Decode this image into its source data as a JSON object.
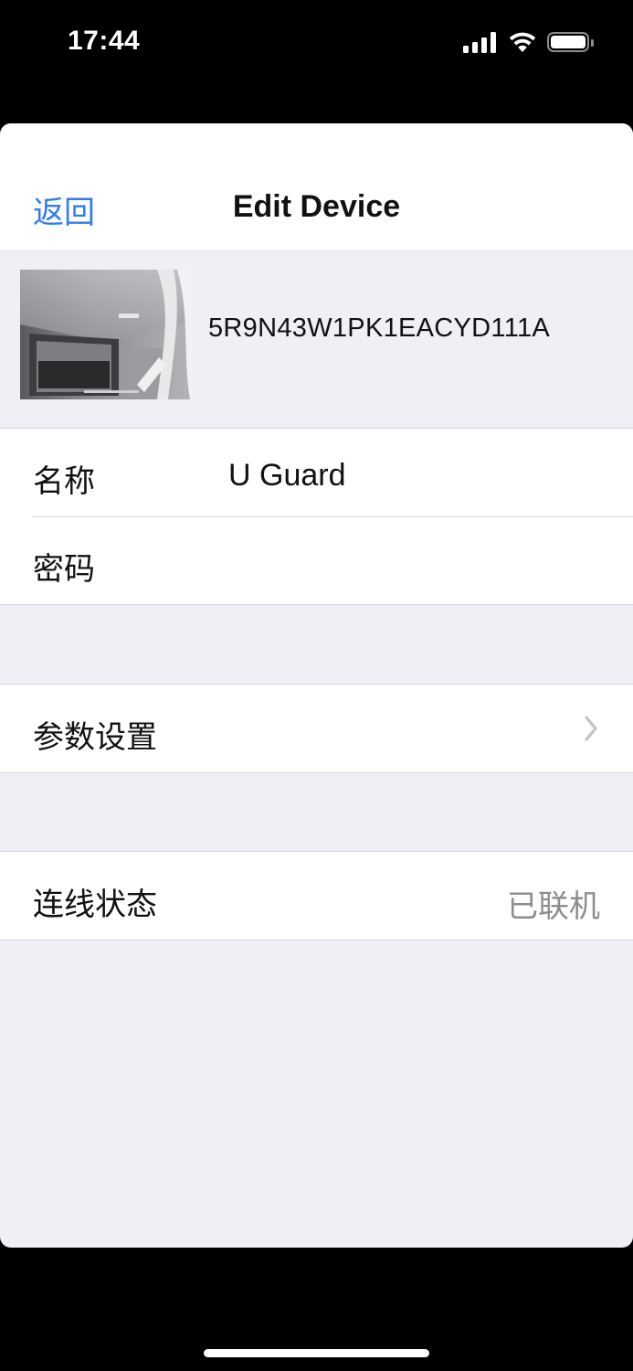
{
  "status_bar": {
    "time": "17:44",
    "icons": [
      "signal-icon",
      "wifi-icon",
      "battery-icon"
    ]
  },
  "nav": {
    "back_label": "返回",
    "title": "Edit Device"
  },
  "device": {
    "serial": "5R9N43W1PK1EACYD111A"
  },
  "info_group": {
    "name_label": "名称",
    "name_value": "U Guard",
    "password_label": "密码",
    "password_value": ""
  },
  "settings_group": {
    "params_label": "参数设置"
  },
  "status_group": {
    "connection_label": "连线状态",
    "connection_value": "已联机"
  },
  "colors": {
    "accent": "#2f7cf6",
    "background": "#f0eff5",
    "secondary_text": "#8d8d92"
  }
}
